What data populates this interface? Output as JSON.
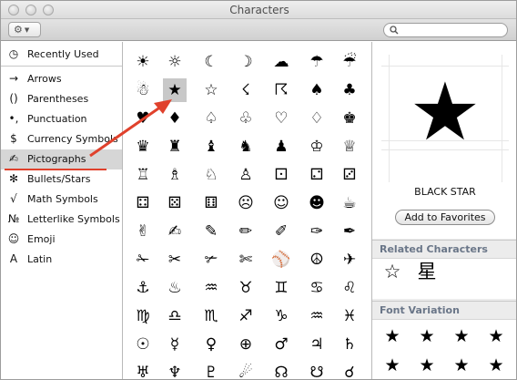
{
  "window": {
    "title": "Characters"
  },
  "toolbar": {
    "action_icon": "gear-icon",
    "search_placeholder": ""
  },
  "sidebar": {
    "items": [
      {
        "icon": "◷",
        "label": "Recently Used",
        "icon_name": "clock-icon"
      },
      {
        "icon": "→",
        "label": "Arrows",
        "icon_name": "arrow-icon"
      },
      {
        "icon": "()",
        "label": "Parentheses",
        "icon_name": "parentheses-icon"
      },
      {
        "icon": "•,",
        "label": "Punctuation",
        "icon_name": "punctuation-icon"
      },
      {
        "icon": "$",
        "label": "Currency Symbols",
        "icon_name": "dollar-icon"
      },
      {
        "icon": "✍",
        "label": "Pictographs",
        "icon_name": "writing-hand-icon"
      },
      {
        "icon": "✻",
        "label": "Bullets/Stars",
        "icon_name": "asterisk-icon"
      },
      {
        "icon": "√",
        "label": "Math Symbols",
        "icon_name": "square-root-icon"
      },
      {
        "icon": "№",
        "label": "Letterlike Symbols",
        "icon_name": "numero-icon"
      },
      {
        "icon": "☺",
        "label": "Emoji",
        "icon_name": "smiley-icon"
      },
      {
        "icon": "A",
        "label": "Latin",
        "icon_name": "latin-a-icon"
      }
    ],
    "selected_index": 5
  },
  "grid": {
    "rows": [
      [
        "☀",
        "☼",
        "☾",
        "☽",
        "☁",
        "☂",
        "☔"
      ],
      [
        "☃",
        "★",
        "☆",
        "☇",
        "☈",
        "♠",
        "♣"
      ],
      [
        "♥",
        "♦",
        "♤",
        "♧",
        "♡",
        "♢",
        "♚"
      ],
      [
        "♛",
        "♜",
        "♝",
        "♞",
        "♟",
        "♔",
        "♕"
      ],
      [
        "♖",
        "♗",
        "♘",
        "♙",
        "⚀",
        "⚁",
        "⚂"
      ],
      [
        "⚃",
        "⚄",
        "⚅",
        "☹",
        "☺",
        "☻",
        "☕"
      ],
      [
        "✌",
        "✍",
        "✎",
        "✏",
        "✐",
        "✑",
        "✒"
      ],
      [
        "✁",
        "✂",
        "✃",
        "✄",
        "⚾",
        "☮",
        "✈"
      ],
      [
        "⚓",
        "♨",
        "♒",
        "♉",
        "♊",
        "♋",
        "♌"
      ],
      [
        "♍",
        "♎",
        "♏",
        "♐",
        "♑",
        "♒",
        "♓"
      ],
      [
        "☉",
        "☿",
        "♀",
        "⊕",
        "♂",
        "♃",
        "♄"
      ],
      [
        "♅",
        "♆",
        "♇",
        "☄",
        "☊",
        "☋",
        "☌"
      ]
    ],
    "selected": {
      "row": 1,
      "col": 1
    }
  },
  "preview": {
    "glyph": "★",
    "name": "BLACK STAR",
    "add_favorites_label": "Add to Favorites"
  },
  "related": {
    "heading": "Related Characters",
    "chars": [
      "☆",
      "星"
    ]
  },
  "font_variation": {
    "heading": "Font Variation",
    "chars": [
      "★",
      "★",
      "★",
      "★",
      "★",
      "★",
      "★",
      "★"
    ]
  },
  "colors": {
    "annotation": "#e0412c",
    "selection": "#c8c8c8",
    "section_heading": "#6a7688"
  }
}
